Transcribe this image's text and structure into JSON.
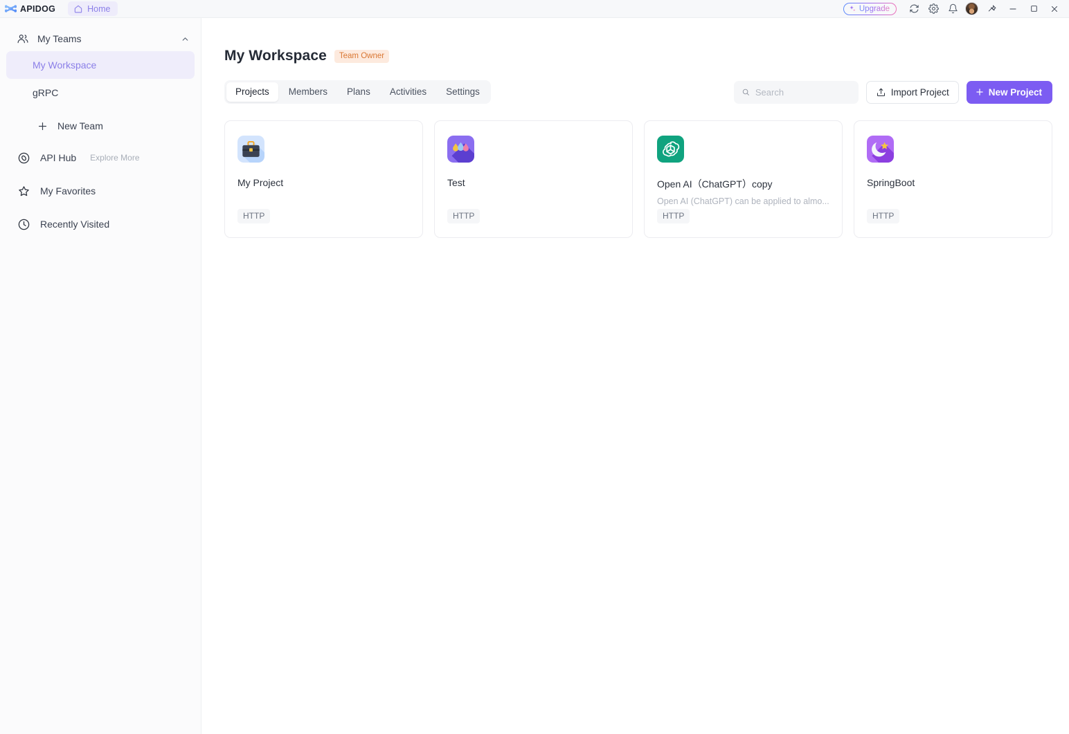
{
  "titlebar": {
    "brand": "APIDOG",
    "home_tab": "Home",
    "upgrade_label": "Upgrade",
    "icons": {
      "sync": "sync-icon",
      "settings": "gear-icon",
      "notifications": "bell-icon",
      "avatar": "user-avatar",
      "pin": "pin-icon",
      "minimize": "minimize-icon",
      "maximize": "maximize-icon",
      "close": "close-icon"
    }
  },
  "sidebar": {
    "teams_header": "My Teams",
    "teams": [
      {
        "label": "My Workspace",
        "active": true
      },
      {
        "label": "gRPC",
        "active": false
      }
    ],
    "new_team_label": "New Team",
    "nav": [
      {
        "label": "API Hub",
        "sub": "Explore More",
        "icon": "compass-icon"
      },
      {
        "label": "My Favorites",
        "sub": "",
        "icon": "star-icon"
      },
      {
        "label": "Recently Visited",
        "sub": "",
        "icon": "clock-icon"
      }
    ]
  },
  "main": {
    "title": "My Workspace",
    "owner_badge": "Team Owner",
    "tabs": [
      {
        "label": "Projects",
        "active": true
      },
      {
        "label": "Members",
        "active": false
      },
      {
        "label": "Plans",
        "active": false
      },
      {
        "label": "Activities",
        "active": false
      },
      {
        "label": "Settings",
        "active": false
      }
    ],
    "search": {
      "value": "",
      "placeholder": "Search"
    },
    "import_label": "Import Project",
    "new_project_label": "New Project",
    "projects": [
      {
        "name": "My Project",
        "desc": "",
        "tag": "HTTP",
        "icon": "briefcase-icon"
      },
      {
        "name": "Test",
        "desc": "",
        "tag": "HTTP",
        "icon": "droplets-icon"
      },
      {
        "name": "Open AI（ChatGPT）copy",
        "desc": "Open AI (ChatGPT) can be applied to almo...",
        "tag": "HTTP",
        "icon": "openai-icon"
      },
      {
        "name": "SpringBoot",
        "desc": "",
        "tag": "HTTP",
        "icon": "moon-star-icon"
      }
    ]
  },
  "colors": {
    "accent": "#7c5cf2",
    "accent_soft": "#8b7fe8",
    "badge_bg": "#fdeade",
    "badge_fg": "#d97733"
  }
}
